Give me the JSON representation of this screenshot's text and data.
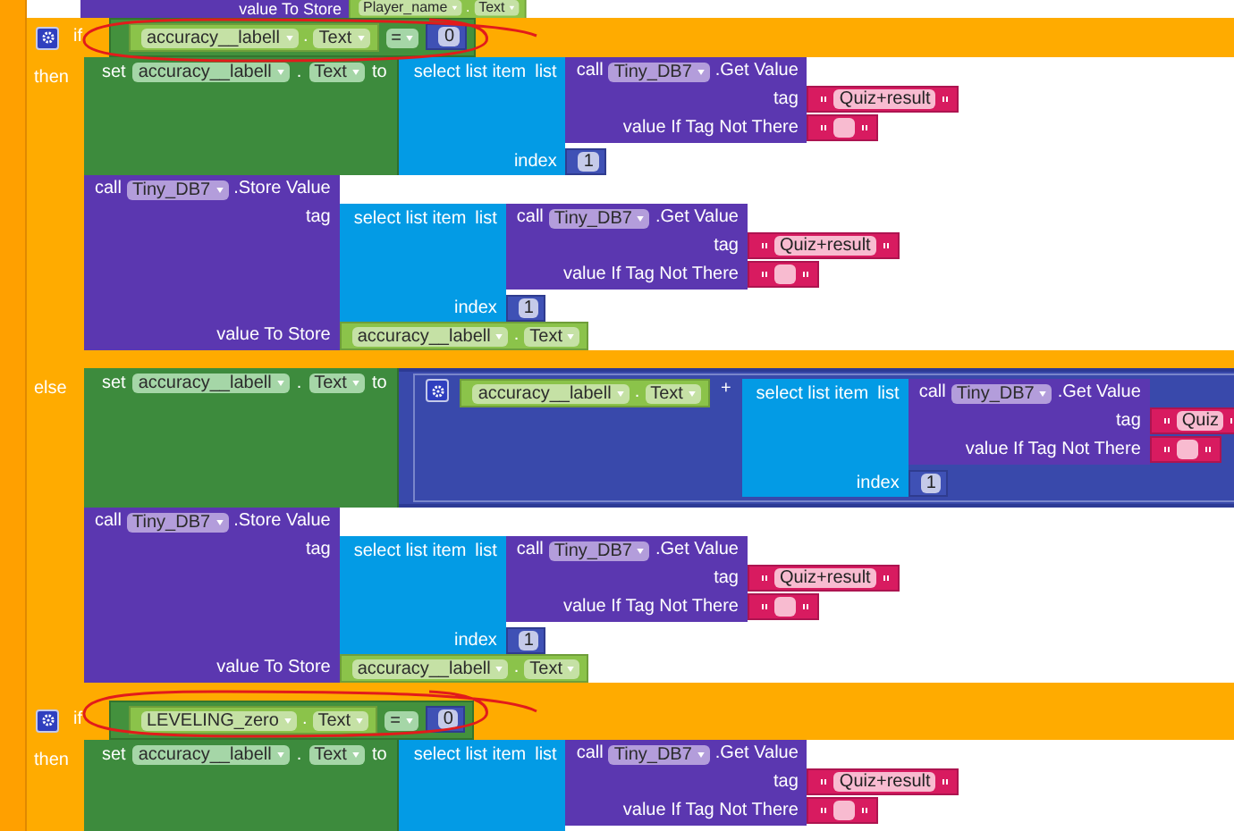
{
  "top_fragment": {
    "label": "value To Store",
    "value": {
      "kind": "getter",
      "component": "Player_name",
      "dot": ".",
      "property": "Text"
    }
  },
  "if_blocks": [
    {
      "kind": "if",
      "branches": [
        {
          "keyword": "if",
          "condition": {
            "kind": "compare",
            "left": {
              "kind": "getter",
              "component": "accuracy__labell",
              "dot": ".",
              "property": "Text"
            },
            "op": "=",
            "right": {
              "kind": "number",
              "value": "0"
            }
          }
        },
        {
          "keyword": "then",
          "statements": [
            {
              "kind": "set",
              "keyword": "set",
              "component": "accuracy__labell",
              "dot": ".",
              "property": "Text",
              "to": "to",
              "value": {
                "kind": "select",
                "label": "select list item",
                "list_label": "list",
                "list": {
                  "kind": "call_get",
                  "call": "call",
                  "component": "Tiny_DB7",
                  "method": ".Get Value",
                  "args": [
                    {
                      "label": "tag",
                      "value": {
                        "kind": "text",
                        "value": "Quiz+result"
                      }
                    },
                    {
                      "label": "value If Tag Not There",
                      "value": {
                        "kind": "text"
                      }
                    }
                  ]
                },
                "index_label": "index",
                "index": {
                  "kind": "number",
                  "value": "1"
                }
              }
            },
            {
              "kind": "call_store",
              "call": "call",
              "component": "Tiny_DB7",
              "method": ".Store Value",
              "args": [
                {
                  "label": "tag",
                  "value": {
                    "kind": "select",
                    "label": "select list item",
                    "list_label": "list",
                    "list": {
                      "kind": "call_get",
                      "call": "call",
                      "component": "Tiny_DB7",
                      "method": ".Get Value",
                      "args": [
                        {
                          "label": "tag",
                          "value": {
                            "kind": "text",
                            "value": "Quiz+result"
                          }
                        },
                        {
                          "label": "value If Tag Not There",
                          "value": {
                            "kind": "text"
                          }
                        }
                      ]
                    },
                    "index_label": "index",
                    "index": {
                      "kind": "number",
                      "value": "1"
                    }
                  }
                },
                {
                  "label": "value To Store",
                  "value": {
                    "kind": "getter",
                    "component": "accuracy__labell",
                    "dot": ".",
                    "property": "Text"
                  }
                }
              ]
            }
          ]
        },
        {
          "keyword": "else",
          "statements": [
            {
              "kind": "set",
              "keyword": "set",
              "component": "accuracy__labell",
              "dot": ".",
              "property": "Text",
              "to": "to",
              "value": {
                "kind": "join",
                "left": {
                  "kind": "getter",
                  "component": "accuracy__labell",
                  "dot": ".",
                  "property": "Text"
                },
                "op": "+",
                "right": {
                  "kind": "select",
                  "label": "select list item",
                  "list_label": "list",
                  "list": {
                    "kind": "call_get",
                    "call": "call",
                    "component": "Tiny_DB7",
                    "method": ".Get Value",
                    "args": [
                      {
                        "label": "tag",
                        "value": {
                          "kind": "text",
                          "value": "Quiz"
                        }
                      },
                      {
                        "label": "value If Tag Not There",
                        "value": {
                          "kind": "text"
                        }
                      }
                    ]
                  },
                  "index_label": "index",
                  "index": {
                    "kind": "number",
                    "value": "1"
                  }
                }
              }
            },
            {
              "kind": "call_store",
              "call": "call",
              "component": "Tiny_DB7",
              "method": ".Store Value",
              "args": [
                {
                  "label": "tag",
                  "value": {
                    "kind": "select",
                    "label": "select list item",
                    "list_label": "list",
                    "list": {
                      "kind": "call_get",
                      "call": "call",
                      "component": "Tiny_DB7",
                      "method": ".Get Value",
                      "args": [
                        {
                          "label": "tag",
                          "value": {
                            "kind": "text",
                            "value": "Quiz+result"
                          }
                        },
                        {
                          "label": "value If Tag Not There",
                          "value": {
                            "kind": "text"
                          }
                        }
                      ]
                    },
                    "index_label": "index",
                    "index": {
                      "kind": "number",
                      "value": "1"
                    }
                  }
                },
                {
                  "label": "value To Store",
                  "value": {
                    "kind": "getter",
                    "component": "accuracy__labell",
                    "dot": ".",
                    "property": "Text"
                  }
                }
              ]
            }
          ]
        }
      ]
    },
    {
      "kind": "if",
      "branches": [
        {
          "keyword": "if",
          "condition": {
            "kind": "compare",
            "left": {
              "kind": "getter",
              "component": "LEVELING_zero",
              "dot": ".",
              "property": "Text"
            },
            "op": "=",
            "right": {
              "kind": "number",
              "value": "0"
            }
          }
        },
        {
          "keyword": "then",
          "statements": [
            {
              "kind": "set",
              "keyword": "set",
              "component": "accuracy__labell",
              "dot": ".",
              "property": "Text",
              "to": "to",
              "value": {
                "kind": "select",
                "label": "select list item",
                "list_label": "list",
                "list": {
                  "kind": "call_get",
                  "call": "call",
                  "component": "Tiny_DB7",
                  "method": ".Get Value",
                  "args": [
                    {
                      "label": "tag",
                      "value": {
                        "kind": "text",
                        "value": "Quiz+result"
                      }
                    },
                    {
                      "label": "value If Tag Not There",
                      "value": {
                        "kind": "text"
                      }
                    }
                  ]
                }
              }
            }
          ]
        }
      ]
    }
  ]
}
